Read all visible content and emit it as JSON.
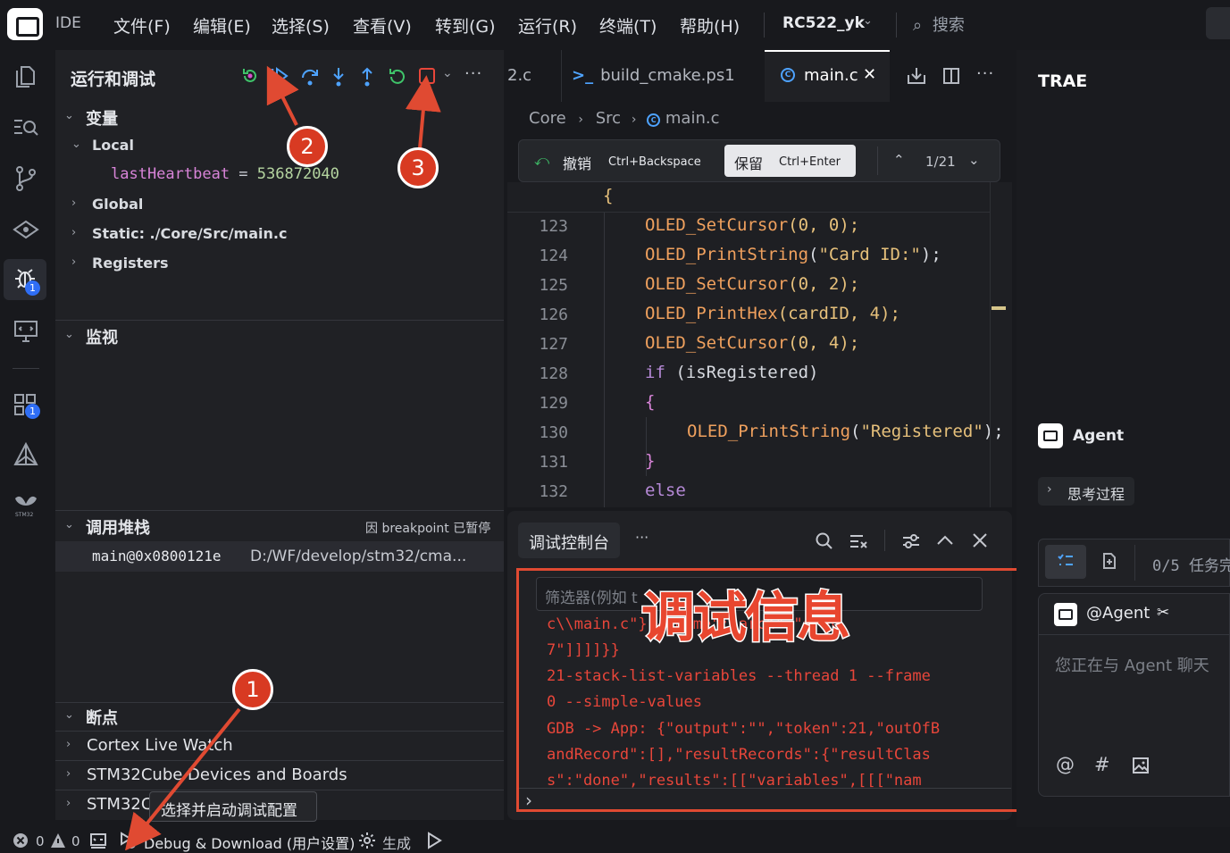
{
  "app": {
    "ide_label": "IDE",
    "menu": [
      "文件(F)",
      "编辑(E)",
      "选择(S)",
      "查看(V)",
      "转到(G)",
      "运行(R)",
      "终端(T)",
      "帮助(H)"
    ],
    "project": "RC522_yk",
    "search_label": "搜索"
  },
  "activity_badges": {
    "debug": "1",
    "extensions": "1"
  },
  "run_debug": {
    "title": "运行和调试",
    "variables_header": "变量",
    "local_label": "Local",
    "var_name": "lastHeartbeat",
    "var_eq": " = ",
    "var_value": "536872040",
    "global_label": "Global",
    "static_label": "Static: ./Core/Src/main.c",
    "registers_label": "Registers",
    "watch_header": "监视",
    "callstack_header": "调用堆栈",
    "callstack_status": "因 breakpoint 已暂停",
    "frame_name": "main@0x0800121e",
    "frame_path": "D:/WF/develop/stm32/cma...",
    "breakpoints_header": "断点",
    "cortex_live_watch": "Cortex Live Watch",
    "stm32cube_devices": "STM32Cube Devices and Boards",
    "stm32_truncated": "STM32C"
  },
  "tabs": {
    "partial": "2.c",
    "build_cmake": "build_cmake.ps1",
    "main_c": "main.c"
  },
  "breadcrumb": [
    "Core",
    "Src",
    "main.c"
  ],
  "diffbar": {
    "undo_label": "撤销",
    "undo_key": "Ctrl+Backspace",
    "keep_label": "保留",
    "keep_key": "Ctrl+Enter",
    "counter": "1/21"
  },
  "code": {
    "top_brace": "{",
    "lines": [
      {
        "n": "123"
      },
      {
        "n": "124"
      },
      {
        "n": "125"
      },
      {
        "n": "126"
      },
      {
        "n": "127"
      },
      {
        "n": "128"
      },
      {
        "n": "129"
      },
      {
        "n": "130"
      },
      {
        "n": "131"
      },
      {
        "n": "132"
      }
    ],
    "l123_fn": "OLED_SetCursor",
    "l123_args": "(0, 0);",
    "l124_fn": "OLED_PrintString",
    "l124_open": "(",
    "l124_str": "\"Card ID:\"",
    "l124_close": ");",
    "l125_fn": "OLED_SetCursor",
    "l125_args": "(0, 2);",
    "l126_fn": "OLED_PrintHex",
    "l126_args": "(cardID, 4);",
    "l127_fn": "OLED_SetCursor",
    "l127_args": "(0, 4);",
    "l128_kw": "if",
    "l128_rest": " (isRegistered)",
    "l129": "{",
    "l130_fn": "OLED_PrintString",
    "l130_open": "(",
    "l130_str": "\"Registered\"",
    "l130_close": ");",
    "l131": "}",
    "l132_kw": "else"
  },
  "console": {
    "title": "调试控制台",
    "more": "···",
    "filter_placeholder": "筛选器(例如 t",
    "lines": [
      "c\\\\main.c\"},{\"name\":\"arch\",\"armv",
      "7\"]]]]}}",
      "21-stack-list-variables --thread 1 --frame",
      "0 --simple-values",
      "GDB -> App: {\"output\":\"\",\"token\":21,\"outOfB",
      "andRecord\":[],\"resultRecords\":{\"resultClas",
      "s\":\"done\",\"results\":[[\"variables\",[[[\"nam"
    ],
    "prompt": "›"
  },
  "right_panel": {
    "brand": "TRAE",
    "agent_label": "Agent",
    "thinking": "思考过程",
    "tasks": "0/5 任务完",
    "agent_mention": "@Agent",
    "chat_placeholder": "您正在与 Agent 聊天"
  },
  "statusbar": {
    "errors": "0",
    "warnings": "0",
    "debug_config": "Debug & Download (用户设置)",
    "build": "生成"
  },
  "annotations": {
    "c1": "1",
    "c2": "2",
    "c3": "3",
    "tooltip": "选择并启动调试配置",
    "big_label": "调试信息"
  },
  "colors": {
    "accent_red": "#e04a32",
    "debug_blue": "#2f6ef5",
    "code_fn": "#f0a15e",
    "code_str": "#e6c07b",
    "console_text": "#e8463a"
  }
}
